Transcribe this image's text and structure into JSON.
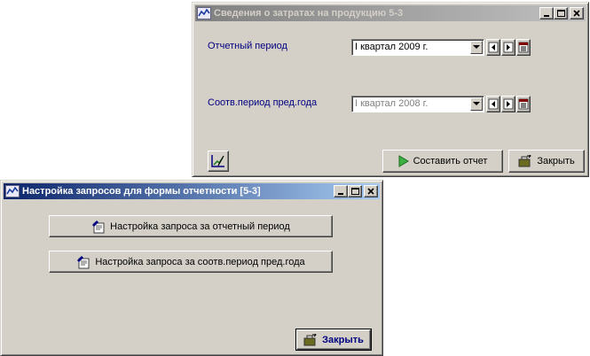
{
  "window_report": {
    "title": "Сведения о затратах на продукцию 5-3",
    "period_label": "Отчетный период",
    "period_value": "I квартал 2009 г.",
    "prev_period_label": "Соотв.период пред.года",
    "prev_period_value": "I квартал 2008 г.",
    "build_button": "Составить отчет",
    "close_button": "Закрыть"
  },
  "window_queries": {
    "title": "Настройка запросов для формы отчетности [5-3]",
    "query_current_button": "Настройка запроса за отчетный период",
    "query_prev_button": "Настройка запроса за соотв.период пред.года",
    "close_button": "Закрыть"
  },
  "colors": {
    "inactive_title": "#808080",
    "active_title": "#0a246a",
    "label_text": "#000080",
    "play_icon": "#3cb043"
  }
}
